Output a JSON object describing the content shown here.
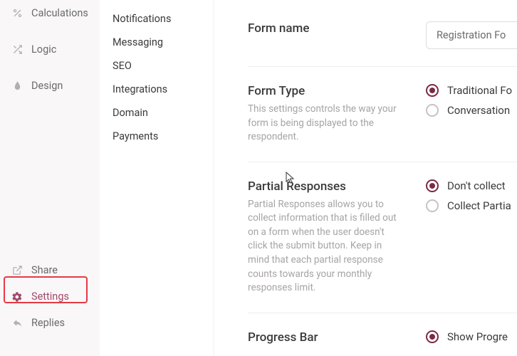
{
  "sidebar": {
    "items": [
      {
        "label": "Calculations",
        "icon": "percent-icon"
      },
      {
        "label": "Logic",
        "icon": "shuffle-icon"
      },
      {
        "label": "Design",
        "icon": "droplet-icon"
      },
      {
        "label": "Share",
        "icon": "external-link-icon"
      },
      {
        "label": "Settings",
        "icon": "gear-icon",
        "active": true
      },
      {
        "label": "Replies",
        "icon": "reply-icon"
      }
    ]
  },
  "subnav": {
    "items": [
      {
        "label": "Notifications"
      },
      {
        "label": "Messaging"
      },
      {
        "label": "SEO"
      },
      {
        "label": "Integrations"
      },
      {
        "label": "Domain"
      },
      {
        "label": "Payments"
      }
    ]
  },
  "form_name": {
    "title": "Form name",
    "value": "Registration Fo"
  },
  "form_type": {
    "title": "Form Type",
    "desc": "This settings controls the way your form is being displayed to the respondent.",
    "options": [
      {
        "label": "Traditional Fo",
        "checked": true
      },
      {
        "label": "Conversation",
        "checked": false
      }
    ]
  },
  "partial": {
    "title": "Partial Responses",
    "desc": "Partial Responses allows you to collect information that is filled out on a form when the user doesn't click the submit button. Keep in mind that each partial response counts towards your monthly responses limit.",
    "options": [
      {
        "label": "Don't collect",
        "checked": true
      },
      {
        "label": "Collect Partia",
        "checked": false
      }
    ]
  },
  "progress": {
    "title": "Progress Bar",
    "options": [
      {
        "label": "Show Progre",
        "checked": true
      }
    ]
  }
}
